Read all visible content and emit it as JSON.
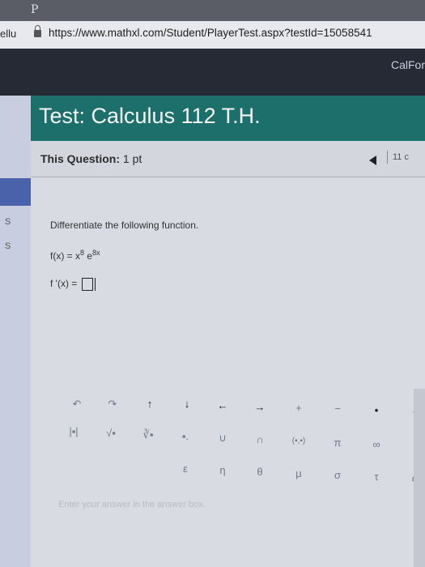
{
  "browser": {
    "tab_letter": "P",
    "left_tab_text": "ellu",
    "url": "https://www.mathxl.com/Student/PlayerTest.aspx?testId=15058541"
  },
  "header": {
    "user_label": "CalFor",
    "title": "Test: Calculus 112 T.H."
  },
  "question_bar": {
    "label": "This Question:",
    "points": "1 pt",
    "question_number": "11 c"
  },
  "question": {
    "instruction": "Differentiate the following function.",
    "function_lhs": "f(x) = x",
    "function_exp": "8",
    "function_base": "e",
    "function_exp2": "8x",
    "answer_label": "f '(x) ="
  },
  "palette": {
    "row1": [
      "↶",
      "↷",
      "↑",
      "↓",
      "←",
      "→",
      "+",
      "−",
      "•",
      "÷"
    ],
    "row2": [
      "|▪|",
      "√▪",
      "∛▪",
      "▪.",
      "∪",
      "∩",
      "(▪,▪)",
      "π",
      "∞",
      "/"
    ],
    "row3": [
      "ε",
      "η",
      "θ",
      "μ",
      "σ",
      "τ",
      "φ"
    ]
  },
  "hint": "Enter your answer in the answer box."
}
